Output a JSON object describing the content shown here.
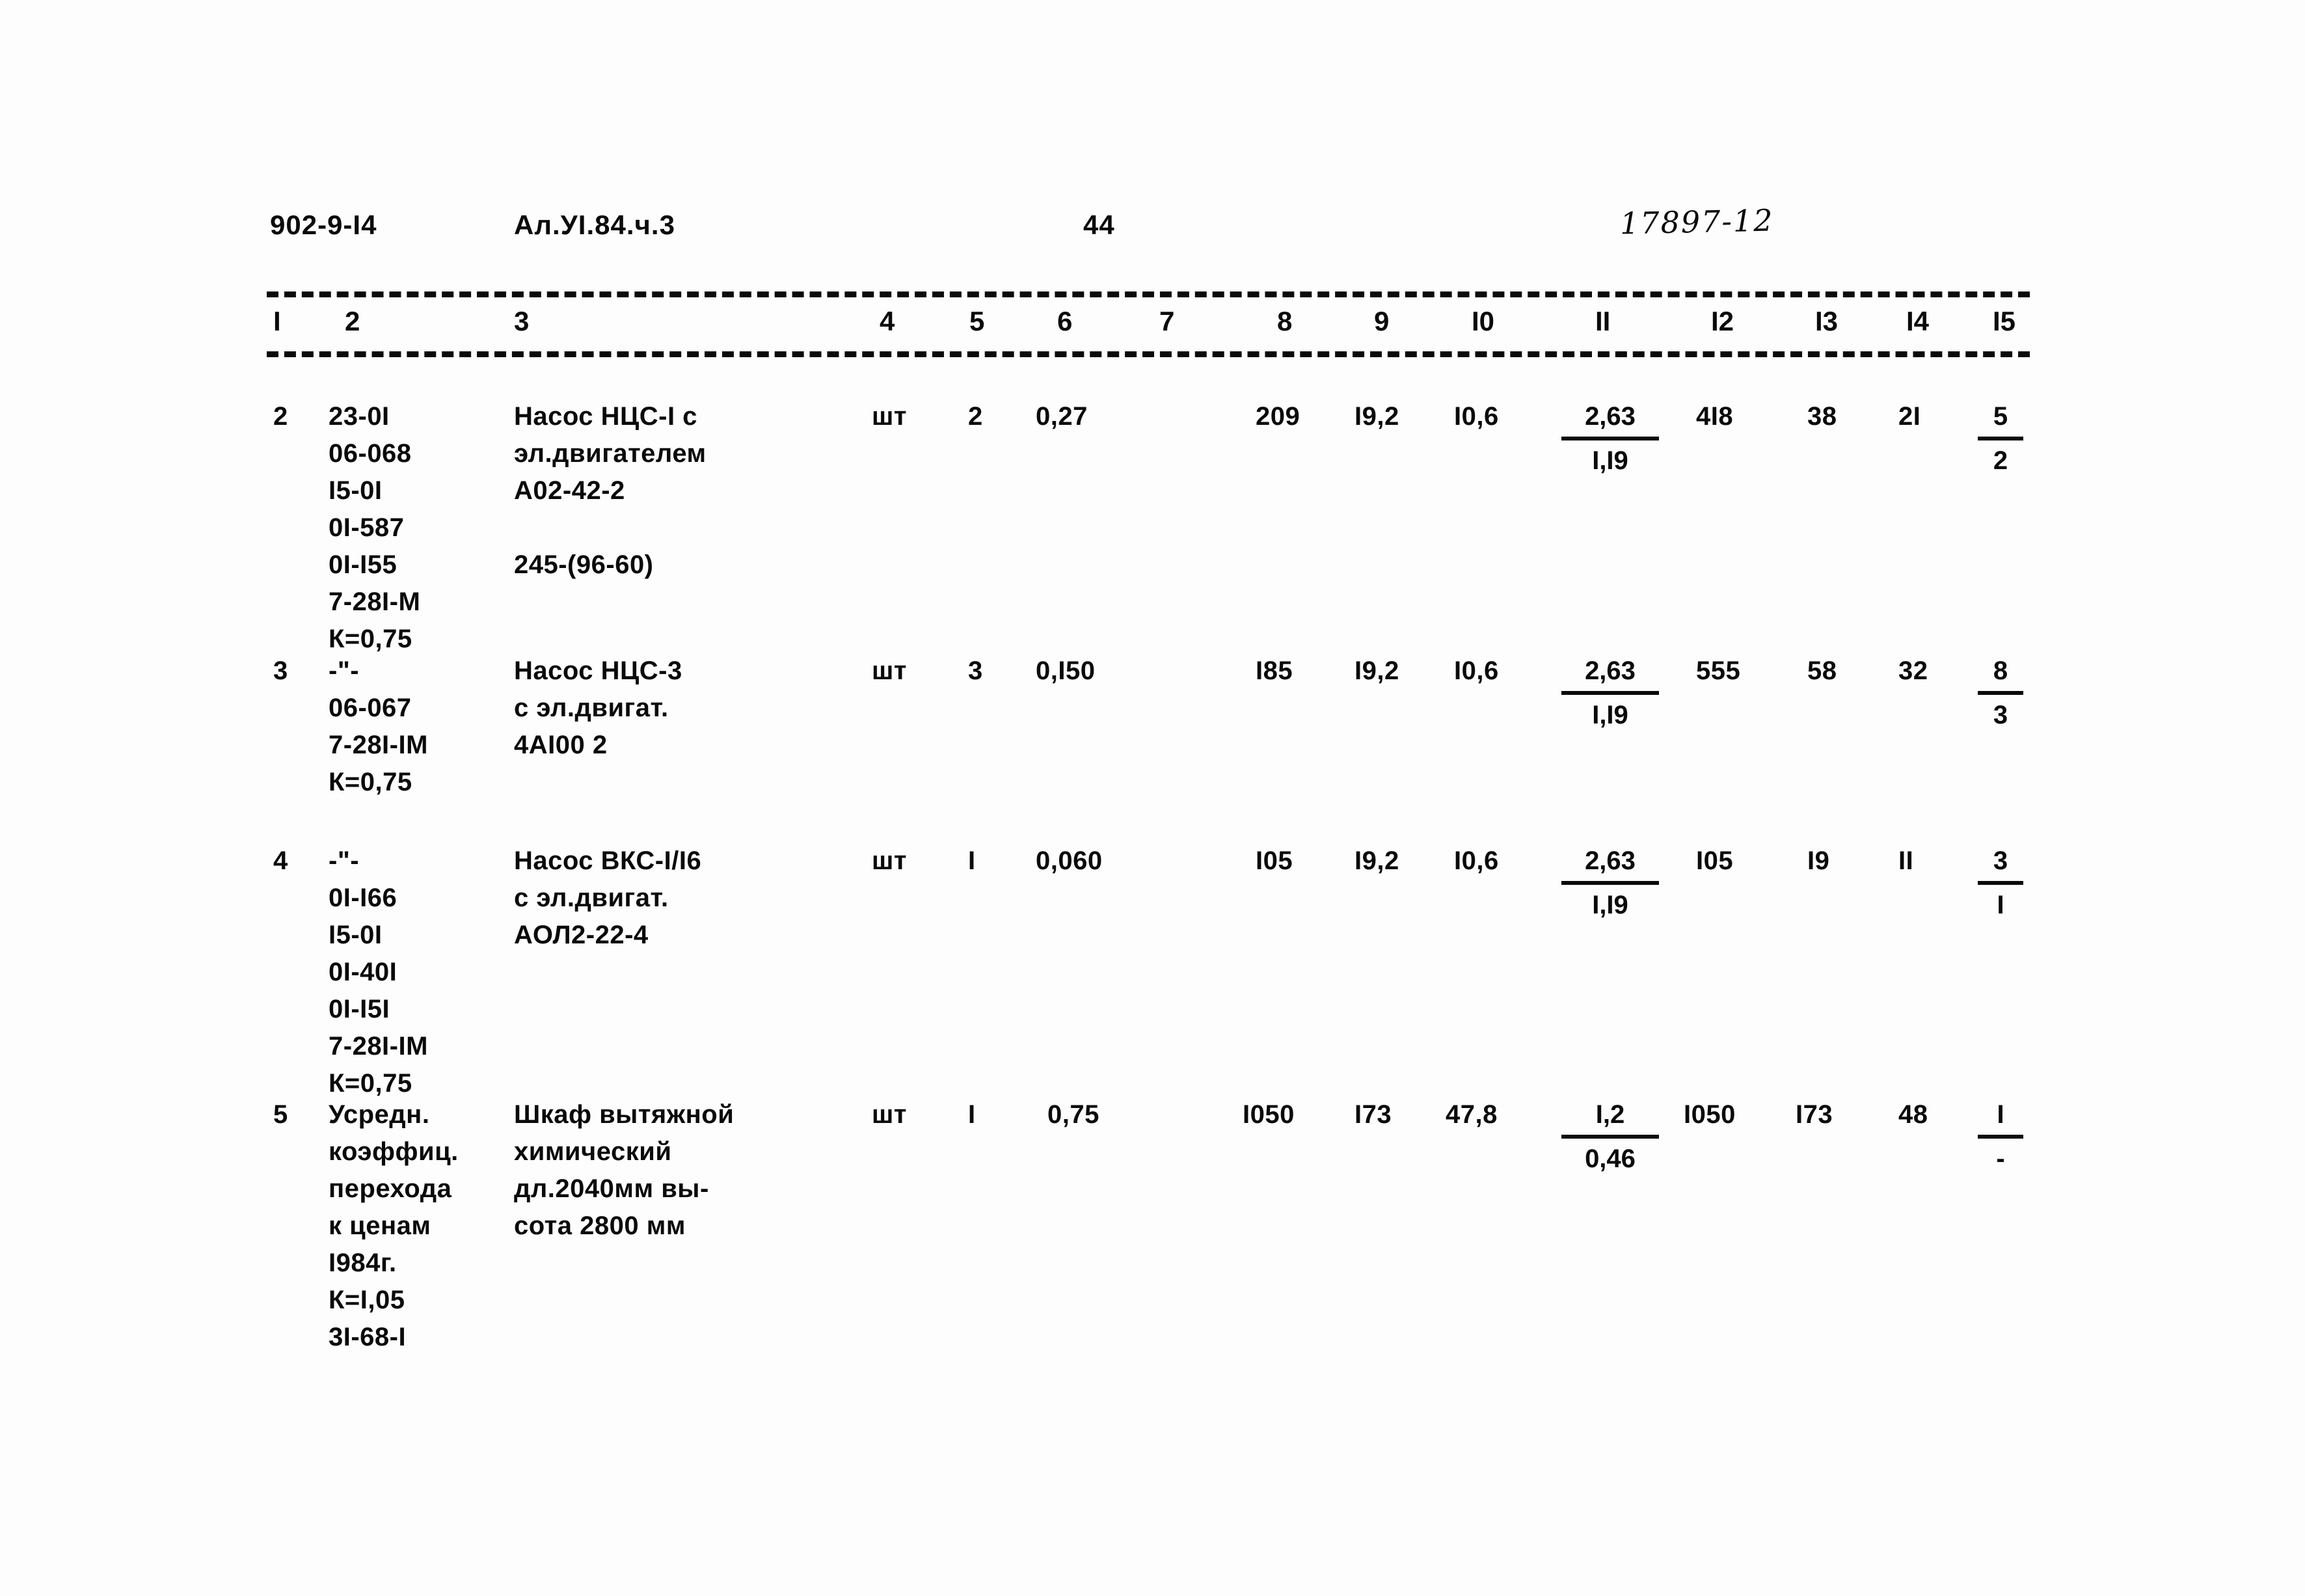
{
  "header": {
    "doc_code": "902-9-I4",
    "album": "Ал.УI.84.ч.3",
    "page_number": "44",
    "stamp": "17897-12"
  },
  "table": {
    "column_headers": [
      "I",
      "2",
      "3",
      "4",
      "5",
      "6",
      "7",
      "8",
      "9",
      "I0",
      "II",
      "I2",
      "I3",
      "I4",
      "I5"
    ],
    "rows": [
      {
        "c1": "2",
        "c2": "23-0I\n06-068\nI5-0I\n0I-587\n0I-I55\n7-28I-М\nК=0,75",
        "c3": "Насос НЦС-I с\nэл.двигателем\nА02-42-2\n\n245-(96-60)",
        "c4": "шт",
        "c5": "2",
        "c6": "0,27",
        "c7": "",
        "c8": "209",
        "c9": "I9,2",
        "c10": "I0,6",
        "c11_num": "2,63",
        "c11_den": "I,I9",
        "c12": "4I8",
        "c13": "38",
        "c14": "2I",
        "c15_num": "5",
        "c15_den": "2"
      },
      {
        "c1": "3",
        "c2": "-\"-\n06-067\n7-28I-IМ\nК=0,75",
        "c3": "Насос НЦС-3\nс эл.двигат.\n4АI00  2",
        "c4": "шт",
        "c5": "3",
        "c6": "0,I50",
        "c7": "",
        "c8": "I85",
        "c9": "I9,2",
        "c10": "I0,6",
        "c11_num": "2,63",
        "c11_den": "I,I9",
        "c12": "555",
        "c13": "58",
        "c14": "32",
        "c15_num": "8",
        "c15_den": "3"
      },
      {
        "c1": "4",
        "c2": "-\"-\n0I-I66\nI5-0I\n0I-40I\n0I-I5I\n7-28I-IМ\nК=0,75",
        "c3": "Насос ВКС-I/I6\nс эл.двигат.\nАОЛ2-22-4",
        "c4": "шт",
        "c5": "I",
        "c6": "0,060",
        "c7": "",
        "c8": "I05",
        "c9": "I9,2",
        "c10": "I0,6",
        "c11_num": "2,63",
        "c11_den": "I,I9",
        "c12": "I05",
        "c13": "I9",
        "c14": "II",
        "c15_num": "3",
        "c15_den": "I"
      },
      {
        "c1": "5",
        "c2": "Усредн.\nкоэффиц.\nперехода\nк ценам\nI984г.\nК=I,05\n3I-68-I",
        "c3": "Шкаф вытяжной\nхимический\nдл.2040мм вы-\nсота 2800 мм",
        "c4": "шт",
        "c5": "I",
        "c6": "0,75",
        "c7": "",
        "c8": "I050",
        "c9": "I73",
        "c10": "47,8",
        "c11_num": "I,2",
        "c11_den": "0,46",
        "c12": "I050",
        "c13": "I73",
        "c14": "48",
        "c15_num": "I",
        "c15_den": "-"
      }
    ]
  }
}
